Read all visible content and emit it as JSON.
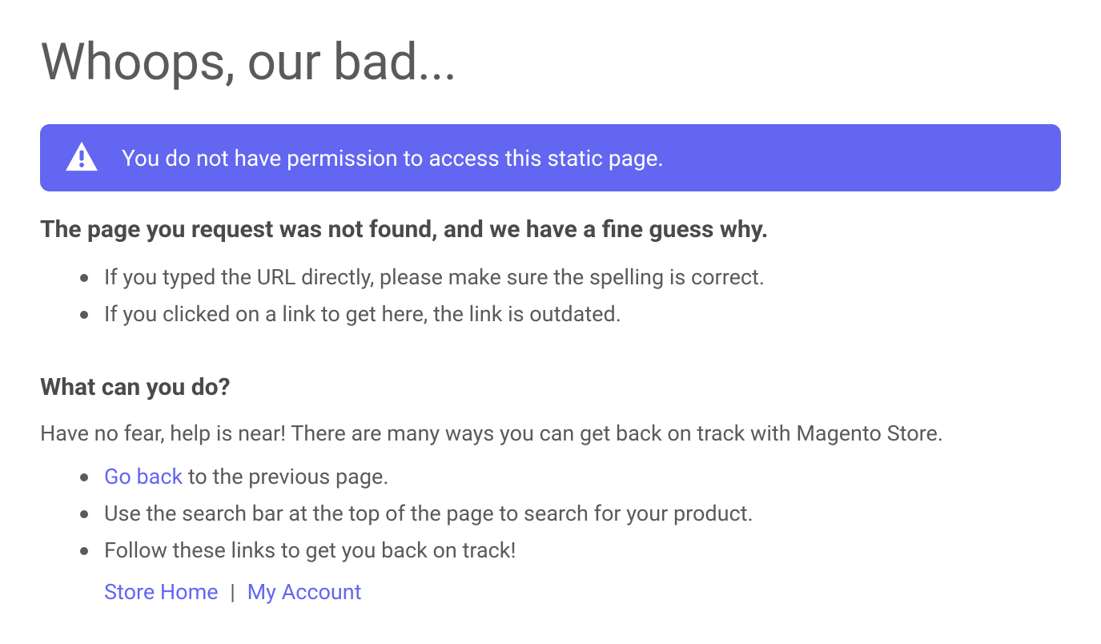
{
  "title": "Whoops, our bad...",
  "alert": {
    "message": "You do not have permission to access this static page."
  },
  "section1": {
    "heading": "The page you request was not found, and we have a fine guess why.",
    "items": [
      "If you typed the URL directly, please make sure the spelling is correct.",
      "If you clicked on a link to get here, the link is outdated."
    ]
  },
  "section2": {
    "heading": "What can you do?",
    "intro": "Have no fear, help is near! There are many ways you can get back on track with Magento Store.",
    "items": {
      "goback_link": "Go back",
      "goback_rest": " to the previous page.",
      "search": "Use the search bar at the top of the page to search for your product.",
      "follow": "Follow these links to get you back on track!"
    },
    "links": {
      "store_home": "Store Home",
      "separator": "|",
      "my_account": "My Account"
    }
  }
}
